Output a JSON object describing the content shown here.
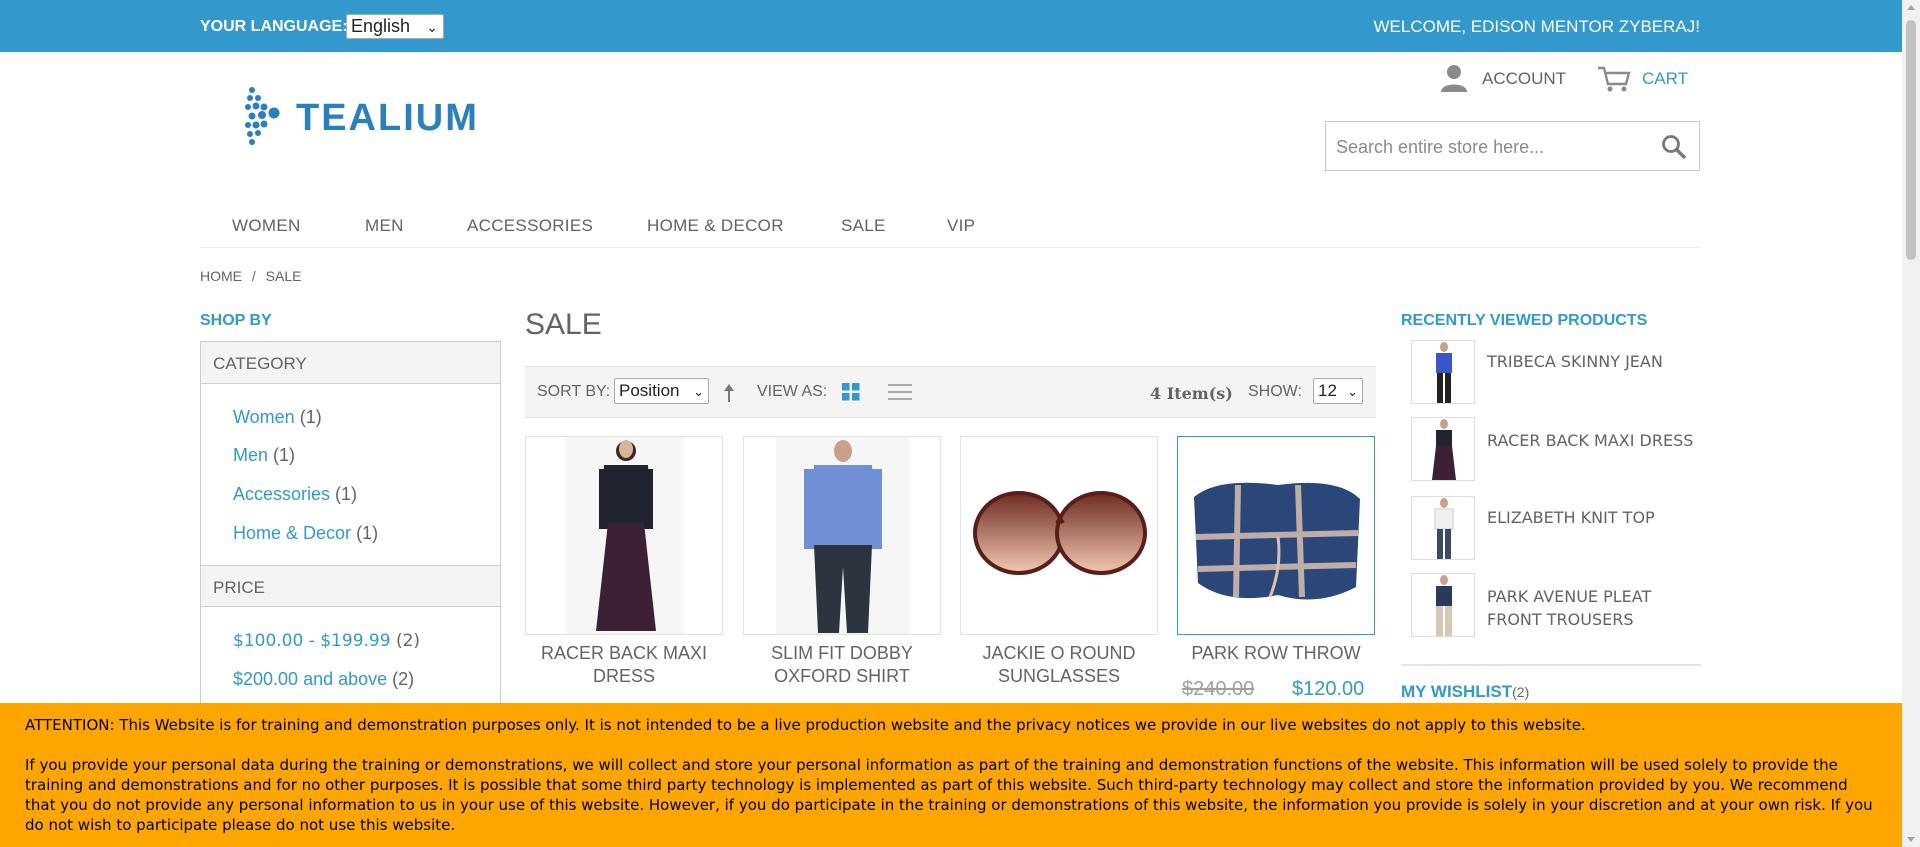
{
  "topbar": {
    "language_label": "YOUR LANGUAGE:",
    "language_value": "English",
    "welcome": "WELCOME, EDISON MENTOR ZYBERAJ!"
  },
  "header": {
    "logo_text": "TEALIUM",
    "account_label": "ACCOUNT",
    "cart_label": "CART",
    "search_placeholder": "Search entire store here..."
  },
  "nav": [
    "WOMEN",
    "MEN",
    "ACCESSORIES",
    "HOME & DECOR",
    "SALE",
    "VIP"
  ],
  "breadcrumb": {
    "home": "HOME",
    "separator": "/",
    "current": "SALE"
  },
  "sidebar": {
    "shop_by": "SHOP BY",
    "category_title": "CATEGORY",
    "categories": [
      {
        "label": "Women",
        "count": "(1)"
      },
      {
        "label": "Men",
        "count": "(1)"
      },
      {
        "label": "Accessories",
        "count": "(1)"
      },
      {
        "label": "Home & Decor",
        "count": "(1)"
      }
    ],
    "price_title": "PRICE",
    "prices": [
      {
        "label": "$100.00 - $199.99",
        "count": "(2)"
      },
      {
        "label": "$200.00 and above",
        "count": "(2)"
      }
    ]
  },
  "main": {
    "title": "SALE",
    "sort_by_label": "SORT BY:",
    "sort_value": "Position",
    "view_as_label": "VIEW AS:",
    "items_count": "4 Item(s)",
    "show_label": "SHOW:",
    "show_value": "12",
    "products": [
      {
        "name": "RACER BACK MAXI DRESS"
      },
      {
        "name": "SLIM FIT DOBBY OXFORD SHIRT"
      },
      {
        "name": "JACKIE O ROUND SUNGLASSES"
      },
      {
        "name": "PARK ROW THROW",
        "old_price": "$240.00",
        "price": "$120.00"
      }
    ]
  },
  "recent": {
    "title": "RECENTLY VIEWED PRODUCTS",
    "items": [
      {
        "name": "TRIBECA SKINNY JEAN"
      },
      {
        "name": "RACER BACK MAXI DRESS"
      },
      {
        "name": "ELIZABETH KNIT TOP"
      },
      {
        "name": "PARK AVENUE PLEAT FRONT TROUSERS"
      }
    ],
    "wishlist_label": "MY WISHLIST",
    "wishlist_count": "(2)"
  },
  "notice": {
    "line1": "ATTENTION: This Website is for training and demonstration purposes only. It is not intended to be a live production website and the privacy notices we provide in our live websites do not apply to this website.",
    "line2": "If you provide your personal data during the training or demonstrations, we will collect and store your personal information as part of the training and demonstration functions of the website. This information will be used solely to provide the training and demonstrations and for no other purposes. It is possible that some third party technology is implemented as part of this website. Such third-party technology may collect and store the information provided by you. We recommend that you do not provide any personal information to us in your use of this website. However, if you do participate in the training or demonstrations of this website, the information you provide is solely in your discretion and at your own risk. If you do not wish to participate please do not use this website."
  },
  "colors": {
    "brand": "#3399cc",
    "notice": "#ffa500",
    "text": "#636363"
  }
}
